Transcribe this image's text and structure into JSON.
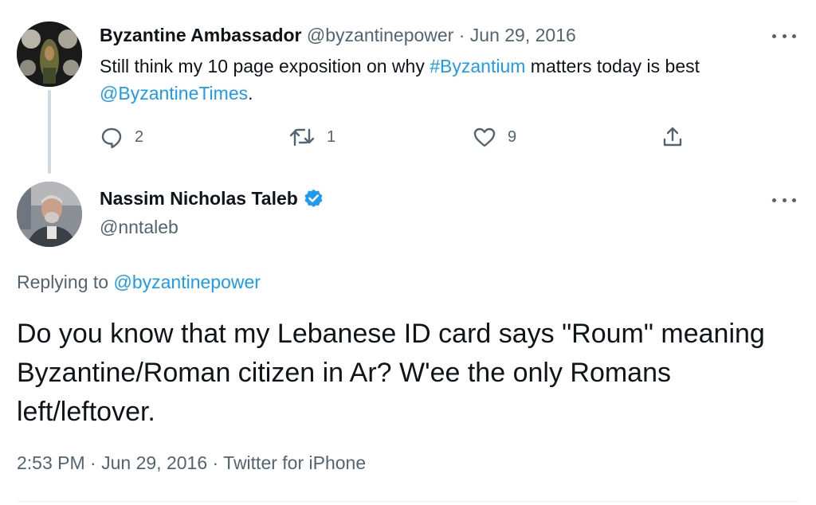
{
  "parent_tweet": {
    "author_name": "Byzantine Ambassador",
    "handle": "@byzantinepower",
    "separator": "·",
    "date": "Jun 29, 2016",
    "text_before": "Still think my 10 page exposition on why ",
    "hashtag": "#Byzantium",
    "text_middle": " matters today is best ",
    "mention": "@ByzantineTimes",
    "text_after": ".",
    "reply_count": "2",
    "retweet_count": "1",
    "like_count": "9",
    "icons": [
      "reply-icon",
      "retweet-icon",
      "like-icon",
      "share-icon",
      "more-icon"
    ]
  },
  "main_tweet": {
    "author_name": "Nassim Nicholas Taleb",
    "handle": "@nntaleb",
    "verified": true,
    "replying_prefix": "Replying to ",
    "replying_to": "@byzantinepower",
    "text": "Do you know that my Lebanese ID card says \"Roum\" meaning Byzantine/Roman citizen in Ar? W'ee the only Romans left/leftover.",
    "time": "2:53 PM",
    "separator": "·",
    "date": "Jun 29, 2016",
    "source": "Twitter for iPhone"
  },
  "colors": {
    "text": "#0f1419",
    "muted": "#536471",
    "link": "#1d9bf0",
    "thread_line": "#cfd9de"
  }
}
